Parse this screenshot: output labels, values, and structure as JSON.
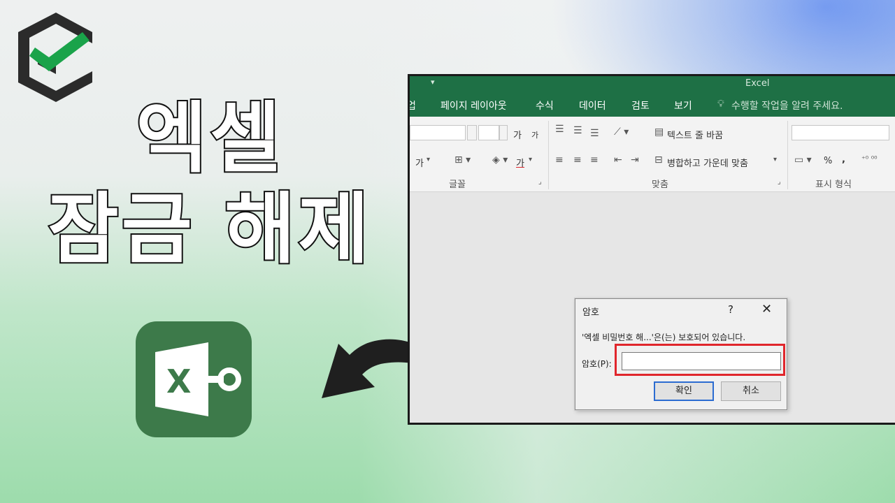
{
  "title": {
    "line1": "엑셀",
    "line2": "잠금 해제"
  },
  "colors": {
    "logo_dark": "#2b2b2b",
    "logo_check": "#1aa34a",
    "excel_green": "#3d7a4a",
    "ribbon_green": "#1e7045",
    "highlight_red": "#e0262c"
  },
  "icons": {
    "logo": "check-hexagon-logo-icon",
    "excel": "excel-key-icon",
    "arrow": "curved-arrow-left-icon"
  },
  "excel_window": {
    "app_title": "Excel",
    "qat_symbol": "▾",
    "tabs": [
      {
        "label": "업"
      },
      {
        "label": "페이지 레이아웃"
      },
      {
        "label": "수식"
      },
      {
        "label": "데이터"
      },
      {
        "label": "검토"
      },
      {
        "label": "보기"
      }
    ],
    "tell_me": "수행할 작업을 알려 주세요.",
    "ribbon": {
      "font_grow": "가",
      "font_shrink": "가",
      "bold_partial": "가",
      "font_color": "가",
      "wrap_text": "텍스트 줄 바꿈",
      "merge_center": "병합하고 가운데 맞춤",
      "percent": "%",
      "comma": ",",
      "groups": {
        "font": "글꼴",
        "alignment": "맞춤",
        "number": "표시 형식"
      }
    }
  },
  "dialog": {
    "title": "암호",
    "help": "?",
    "close": "✕",
    "message": "'엑셀 비밀번호 해...'은(는) 보호되어 있습니다.",
    "password_label": "암호(P):",
    "password_value": "",
    "ok_label": "확인",
    "cancel_label": "취소"
  }
}
